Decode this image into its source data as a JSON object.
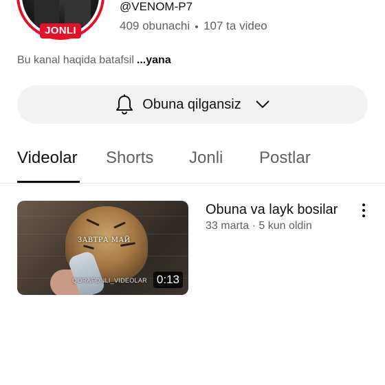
{
  "channel": {
    "handle": "@VENOM-P7",
    "subscribers": "409 obunachi",
    "videos_count": "107 ta video",
    "live_badge": "JONLI",
    "about": "Bu kanal haqida batafsil",
    "about_more": "...yana",
    "ring_color": "#e5102a"
  },
  "subscribe_button": {
    "label": "Obuna qilgansiz",
    "icon": "bell-icon",
    "dropdown_icon": "chevron-down-icon"
  },
  "tabs": [
    {
      "label": "Videolar",
      "active": true
    },
    {
      "label": "Shorts",
      "active": false
    },
    {
      "label": "Jonli",
      "active": false
    },
    {
      "label": "Postlar",
      "active": false
    }
  ],
  "videos": [
    {
      "title": "Obuna va layk bosilar",
      "meta": "33 marta · 5 kun oldin",
      "duration": "0:13",
      "thumbnail_caption_top": "ЗАВТРА МАЙ",
      "thumbnail_caption_bottom": "QORAFONLI_VIDEOLAR"
    }
  ]
}
